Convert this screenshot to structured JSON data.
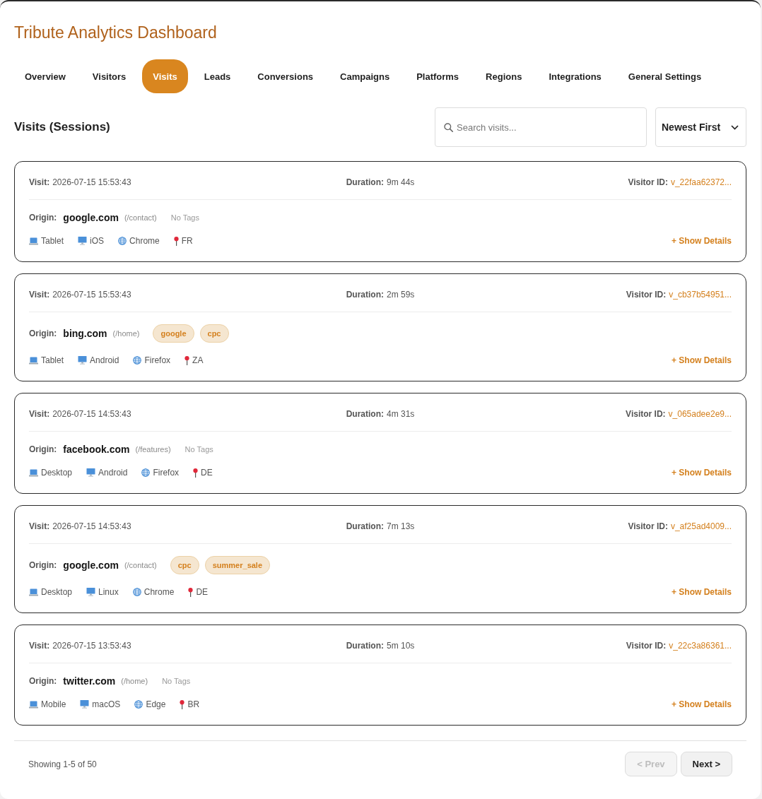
{
  "title": "Tribute Analytics Dashboard",
  "tabs": [
    {
      "label": "Overview",
      "selected": false
    },
    {
      "label": "Visitors",
      "selected": false
    },
    {
      "label": "Visits",
      "selected": true
    },
    {
      "label": "Leads",
      "selected": false
    },
    {
      "label": "Conversions",
      "selected": false
    },
    {
      "label": "Campaigns",
      "selected": false
    },
    {
      "label": "Platforms",
      "selected": false
    },
    {
      "label": "Regions",
      "selected": false
    },
    {
      "label": "Integrations",
      "selected": false
    },
    {
      "label": "General Settings",
      "selected": false
    }
  ],
  "section": {
    "heading": "Visits (Sessions)",
    "search": {
      "placeholder": "Search visits..."
    },
    "sort": {
      "value": "Newest First"
    }
  },
  "visits": [
    {
      "visit_label": "Visit:",
      "time": "2026-07-15 15:53:43",
      "duration_label": "Duration:",
      "duration": "9m 44s",
      "visitor_label": "Visitor ID:",
      "visitor_id": "v_22faa62372...",
      "origin_label": "Origin:",
      "domain": "google.com",
      "path": "(/contact)",
      "no_tags": "No Tags",
      "device": "Tablet",
      "os": "iOS",
      "browser": "Chrome",
      "country": "FR",
      "details_link": "+ Show Details"
    },
    {
      "visit_label": "Visit:",
      "time": "2026-07-15 15:53:43",
      "duration_label": "Duration:",
      "duration": "2m 59s",
      "visitor_label": "Visitor ID:",
      "visitor_id": "v_cb37b54951...",
      "origin_label": "Origin:",
      "domain": "bing.com",
      "path": "(/home)",
      "tags": [
        "google",
        "cpc"
      ],
      "device": "Tablet",
      "os": "Android",
      "browser": "Firefox",
      "country": "ZA",
      "details_link": "+ Show Details"
    },
    {
      "visit_label": "Visit:",
      "time": "2026-07-15 14:53:43",
      "duration_label": "Duration:",
      "duration": "4m 31s",
      "visitor_label": "Visitor ID:",
      "visitor_id": "v_065adee2e9...",
      "origin_label": "Origin:",
      "domain": "facebook.com",
      "path": "(/features)",
      "no_tags": "No Tags",
      "device": "Desktop",
      "os": "Android",
      "browser": "Firefox",
      "country": "DE",
      "details_link": "+ Show Details"
    },
    {
      "visit_label": "Visit:",
      "time": "2026-07-15 14:53:43",
      "duration_label": "Duration:",
      "duration": "7m 13s",
      "visitor_label": "Visitor ID:",
      "visitor_id": "v_af25ad4009...",
      "origin_label": "Origin:",
      "domain": "google.com",
      "path": "(/contact)",
      "tags": [
        "cpc",
        "summer_sale"
      ],
      "device": "Desktop",
      "os": "Linux",
      "browser": "Chrome",
      "country": "DE",
      "details_link": "+ Show Details"
    },
    {
      "visit_label": "Visit:",
      "time": "2026-07-15 13:53:43",
      "duration_label": "Duration:",
      "duration": "5m 10s",
      "visitor_label": "Visitor ID:",
      "visitor_id": "v_22c3a86361...",
      "origin_label": "Origin:",
      "domain": "twitter.com",
      "path": "(/home)",
      "no_tags": "No Tags",
      "device": "Mobile",
      "os": "macOS",
      "browser": "Edge",
      "country": "BR",
      "details_link": "+ Show Details"
    }
  ],
  "pagination": {
    "summary": "Showing 1-5 of 50",
    "prev": {
      "label": "< Prev",
      "disabled": true
    },
    "next": {
      "label": "Next >",
      "disabled": false
    }
  }
}
